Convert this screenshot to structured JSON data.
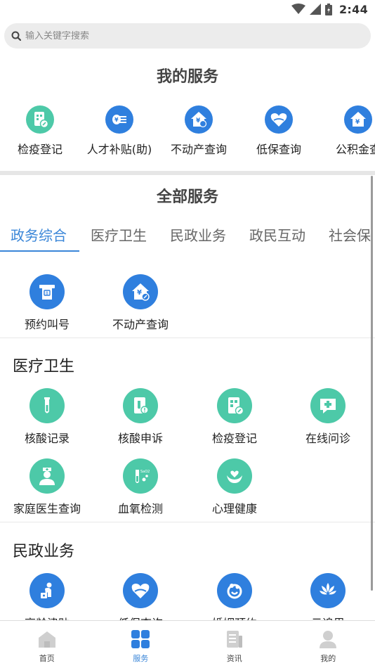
{
  "status_bar": {
    "time": "2:44"
  },
  "search": {
    "placeholder": "输入关键字搜索"
  },
  "my_services": {
    "title": "我的服务",
    "items": [
      {
        "label": "检疫登记",
        "icon": "quarantine-register-icon"
      },
      {
        "label": "人才补贴(助)",
        "icon": "talent-subsidy-icon"
      },
      {
        "label": "不动产查询",
        "icon": "real-estate-query-icon"
      },
      {
        "label": "低保查询",
        "icon": "subsistence-allowance-icon"
      },
      {
        "label": "公积金查",
        "icon": "housing-fund-icon"
      }
    ]
  },
  "all_services": {
    "title": "全部服务",
    "tabs": [
      "政务综合",
      "医疗卫生",
      "民政业务",
      "政民互动",
      "社会保"
    ],
    "active_tab": 0,
    "gov_items": [
      {
        "label": "预约叫号",
        "icon": "queue-number-icon"
      },
      {
        "label": "不动产查询",
        "icon": "real-estate-query-icon"
      }
    ],
    "medical": {
      "title": "医疗卫生",
      "items": [
        {
          "label": "核酸记录",
          "icon": "test-tube-icon"
        },
        {
          "label": "核酸申诉",
          "icon": "test-appeal-icon"
        },
        {
          "label": "检疫登记",
          "icon": "quarantine-register-icon"
        },
        {
          "label": "在线问诊",
          "icon": "medical-cross-icon"
        },
        {
          "label": "家庭医生查询",
          "icon": "family-doctor-icon"
        },
        {
          "label": "血氧检测",
          "icon": "blood-oxygen-icon"
        },
        {
          "label": "心理健康",
          "icon": "mental-health-icon"
        }
      ]
    },
    "civil": {
      "title": "民政业务",
      "items": [
        {
          "label": "高龄津贴",
          "icon": "elderly-allowance-icon"
        },
        {
          "label": "低保查询",
          "icon": "subsistence-allowance-icon"
        },
        {
          "label": "婚姻预约",
          "icon": "marriage-appointment-icon"
        },
        {
          "label": "云追思",
          "icon": "cloud-memorial-icon"
        }
      ]
    }
  },
  "bottom_nav": {
    "items": [
      {
        "label": "首页",
        "icon": "home-icon"
      },
      {
        "label": "服务",
        "icon": "services-grid-icon"
      },
      {
        "label": "资讯",
        "icon": "news-icon"
      },
      {
        "label": "我的",
        "icon": "profile-icon"
      }
    ],
    "active": 1
  },
  "colors": {
    "accent": "#3a86d8",
    "teal": "#4dc9a8",
    "blue": "#2f7fde"
  }
}
